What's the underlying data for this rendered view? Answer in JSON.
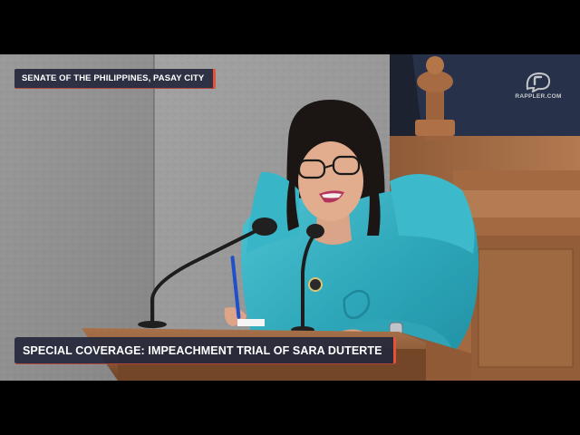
{
  "broadcast": {
    "location_tag": "SENATE OF THE PHILIPPINES, PASAY CITY",
    "coverage_title": "SPECIAL COVERAGE: IMPEACHMENT TRIAL OF SARA DUTERTE",
    "watermark": "RAPPLER.COM",
    "watermark_icon": "rappler-logo-icon",
    "accent_color": "#e8503a",
    "banner_color": "#24283c"
  }
}
